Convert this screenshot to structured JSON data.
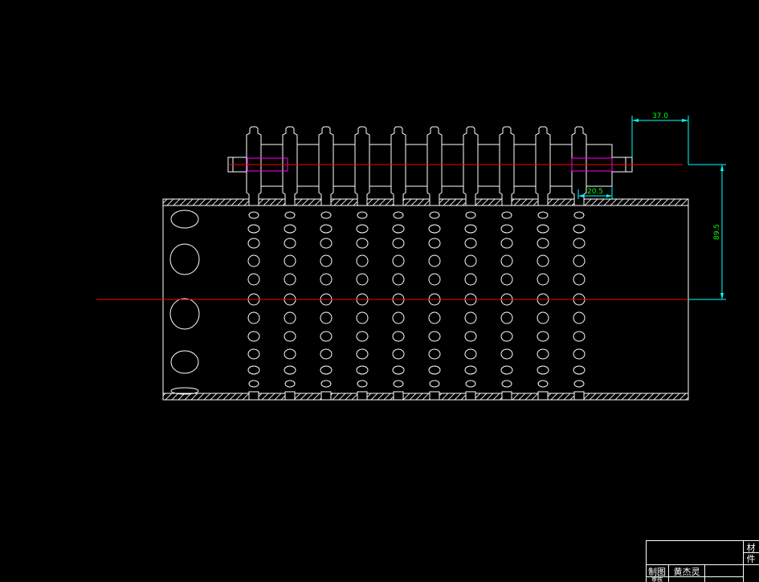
{
  "colors": {
    "background": "#000000",
    "outline": "#ffffff",
    "centerline": "#ff0000",
    "dimension_line": "#00ffff",
    "dimension_text": "#00ff00",
    "hidden_feature": "#ff00ff"
  },
  "dimensions": {
    "shaft_extension": "37.0",
    "tooth_offset": "20.5",
    "center_distance": "89.5"
  },
  "title_block": {
    "drawn_by_label": "制图",
    "drawn_by_name": "黄杰灵",
    "checked_label": "审核",
    "material_label": "材",
    "quantity_label": "件"
  }
}
